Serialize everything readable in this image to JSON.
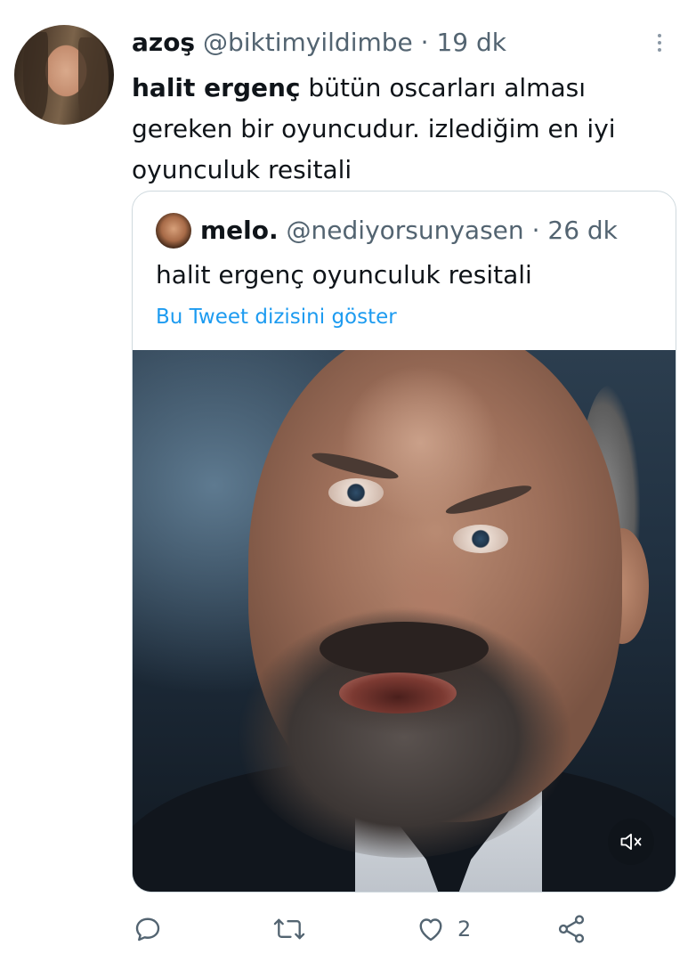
{
  "author": {
    "name": "azoş",
    "handle": "@biktimyildimbe",
    "time": "19 dk"
  },
  "tweet": {
    "text_bold": "halit ergenç",
    "text_line1_rest": " bütün oscarları alması",
    "text_line2": "gereken bir oyuncudur. izlediğim en iyi",
    "text_line3": "oyunculuk resitali"
  },
  "quoted": {
    "name": "melo.",
    "handle": "@nediyorsunyasen",
    "time": "26 dk",
    "text": "halit ergenç oyunculuk resitali",
    "thread_link": "Bu Tweet dizisini göster"
  },
  "actions": {
    "reply_icon": "reply-icon",
    "retweet_icon": "retweet-icon",
    "like_icon": "like-icon",
    "like_count": "2",
    "share_icon": "share-icon"
  },
  "colors": {
    "link": "#1d9bf0",
    "muted": "#536471",
    "border": "#cfd9de"
  }
}
